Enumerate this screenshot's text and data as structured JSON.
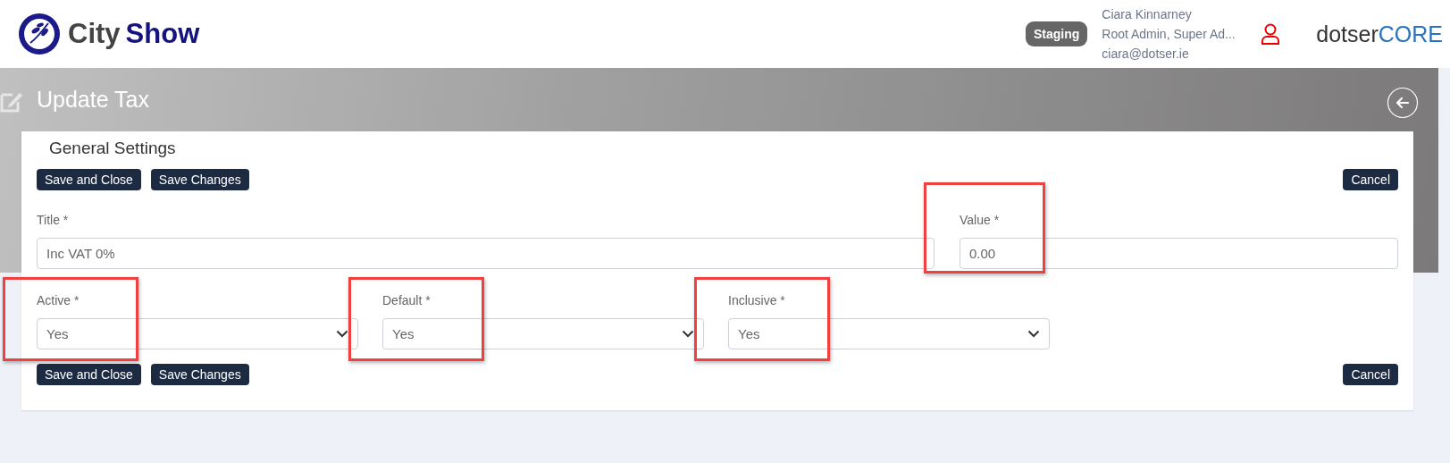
{
  "header": {
    "logo": {
      "part_1": "City",
      "part_2": "Show"
    },
    "environment_badge": "Staging",
    "user": {
      "name": "Ciara Kinnarney",
      "roles": "Root Admin, Super Ad...",
      "email": "ciara@dotser.ie"
    },
    "brand": {
      "part_1": "dotser",
      "part_2": "CORE"
    }
  },
  "page": {
    "title": "Update Tax"
  },
  "card": {
    "title": "General Settings",
    "top_buttons": [
      {
        "label": "Save and Close",
        "kind": "primary"
      },
      {
        "label": "Save Changes",
        "kind": "primary"
      },
      {
        "label": "Cancel",
        "kind": "cancel"
      }
    ],
    "fields": [
      {
        "kind": "text",
        "label": "Title *",
        "value": "Inc VAT 0%",
        "highlighted": false
      },
      {
        "kind": "text",
        "label": "Value *",
        "value": "0.00",
        "highlighted": true
      },
      {
        "kind": "select",
        "label": "Active *",
        "value": "Yes",
        "highlighted": true
      },
      {
        "kind": "select",
        "label": "Default *",
        "value": "Yes",
        "highlighted": true
      },
      {
        "kind": "select",
        "label": "Inclusive *",
        "value": "Yes",
        "highlighted": true
      }
    ],
    "bottom_buttons": [
      {
        "label": "Save and Close",
        "kind": "primary"
      },
      {
        "label": "Save Changes",
        "kind": "primary"
      },
      {
        "label": "Cancel",
        "kind": "cancel"
      }
    ]
  }
}
